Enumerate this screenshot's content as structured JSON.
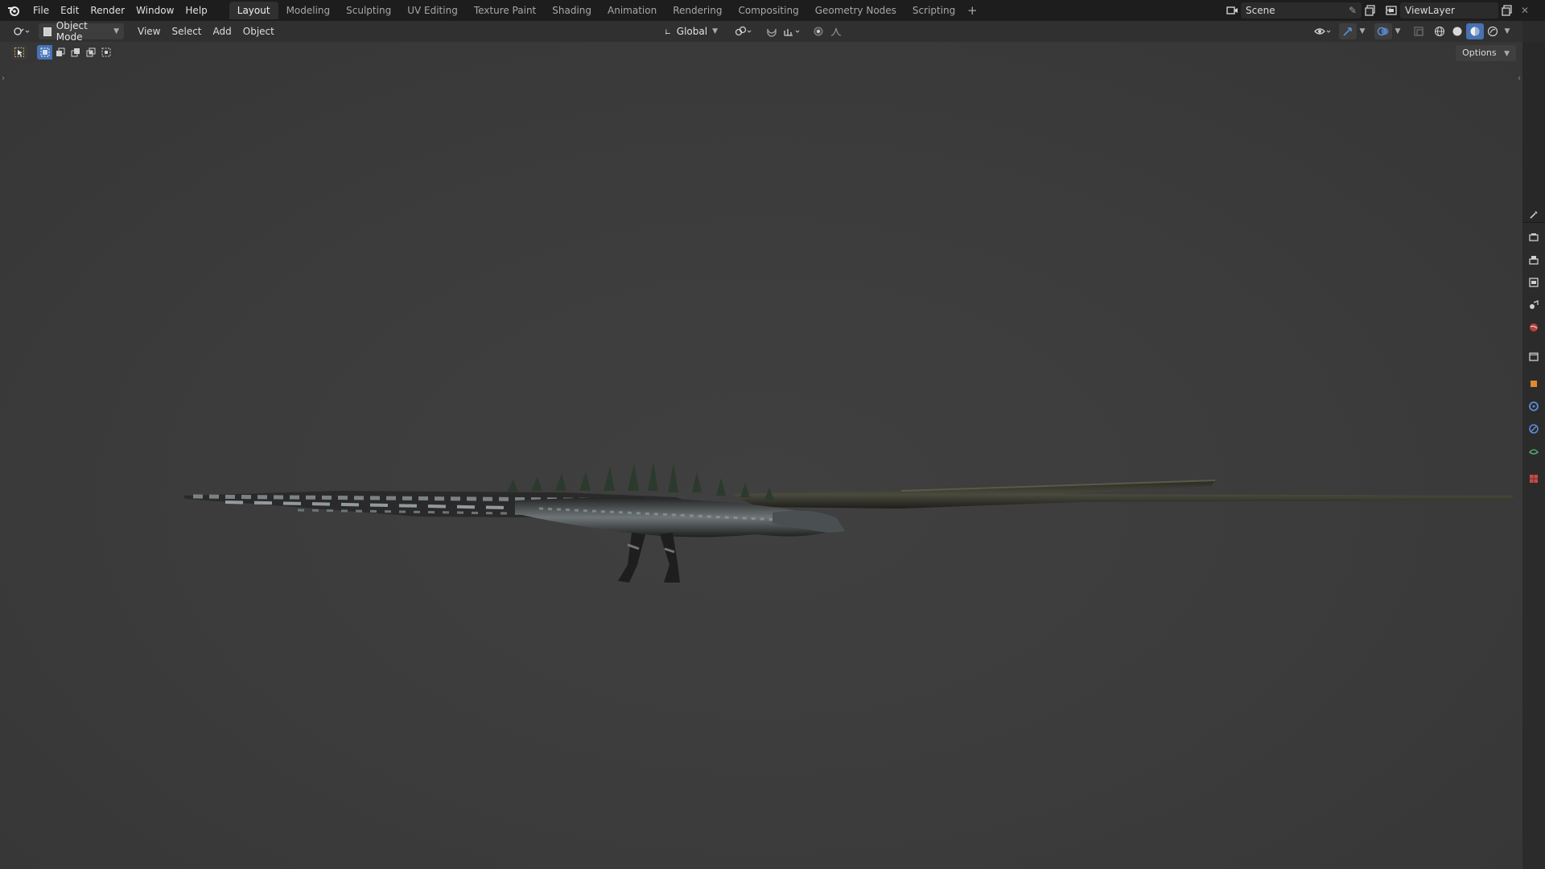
{
  "app": {
    "menu": [
      "File",
      "Edit",
      "Render",
      "Window",
      "Help"
    ],
    "workspaces": [
      {
        "label": "Layout",
        "active": true
      },
      {
        "label": "Modeling",
        "active": false
      },
      {
        "label": "Sculpting",
        "active": false
      },
      {
        "label": "UV Editing",
        "active": false
      },
      {
        "label": "Texture Paint",
        "active": false
      },
      {
        "label": "Shading",
        "active": false
      },
      {
        "label": "Animation",
        "active": false
      },
      {
        "label": "Rendering",
        "active": false
      },
      {
        "label": "Compositing",
        "active": false
      },
      {
        "label": "Geometry Nodes",
        "active": false
      },
      {
        "label": "Scripting",
        "active": false
      }
    ],
    "add_workspace": "+",
    "scene": "Scene",
    "view_layer": "ViewLayer"
  },
  "viewport_header": {
    "mode": "Object Mode",
    "menus": [
      "View",
      "Select",
      "Add",
      "Object"
    ],
    "transform_orientation": "Global",
    "options_label": "Options"
  },
  "colors": {
    "accent_blue": "#4772b3",
    "viewport_bg": "#3c3c3c",
    "header_bg": "#303030"
  },
  "icons": [
    "blender-logo-icon",
    "editor-type-icon",
    "object-mode-icon",
    "select-box-icon",
    "pivot-icon",
    "snap-icon",
    "proportional-icon",
    "visibility-icon",
    "gizmo-icon",
    "overlay-icon",
    "xray-icon",
    "wireframe-shading-icon",
    "solid-shading-icon",
    "material-shading-icon",
    "rendered-shading-icon"
  ]
}
